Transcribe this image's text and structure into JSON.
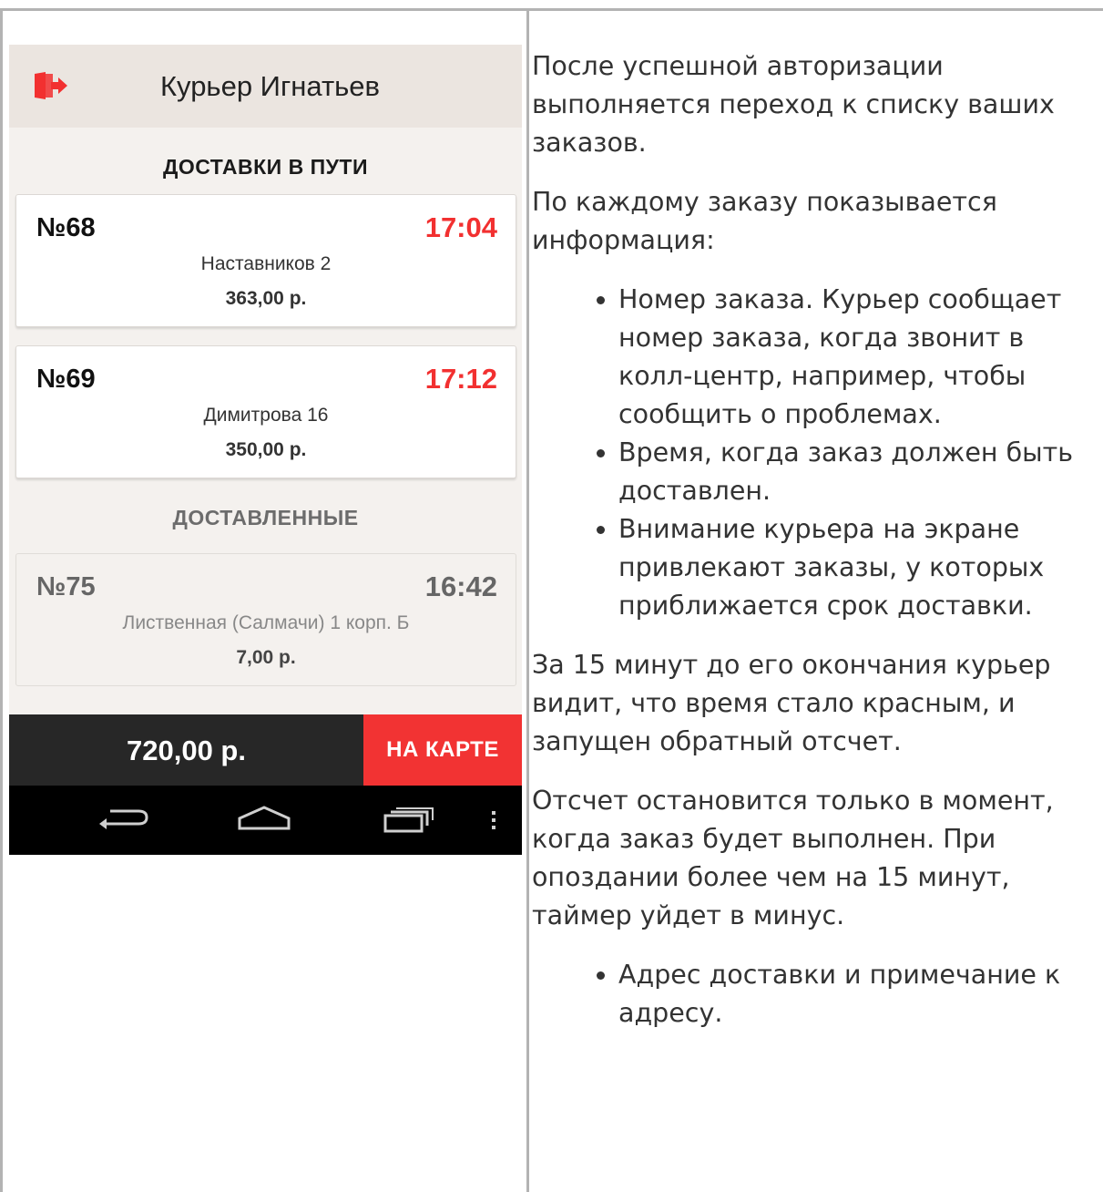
{
  "app": {
    "header": {
      "courier_name": "Курьер Игнатьев",
      "logout_icon": "logout-door-icon",
      "accent": "#f23030"
    },
    "sections": {
      "active_title": "ДОСТАВКИ В ПУТИ",
      "done_title": "ДОСТАВЛЕННЫЕ"
    },
    "active_orders": [
      {
        "number": "№68",
        "time": "17:04",
        "address": "Наставников 2",
        "price": "363,00 р."
      },
      {
        "number": "№69",
        "time": "17:12",
        "address": "Димитрова 16",
        "price": "350,00 р."
      }
    ],
    "done_orders": [
      {
        "number": "№75",
        "time": "16:42",
        "address": "Лиственная (Салмачи) 1 корп. Б",
        "price": "7,00 р."
      }
    ],
    "bottom_bar": {
      "total": "720,00 р.",
      "map_button": "НА КАРТЕ"
    },
    "nav_bar": {
      "icons": [
        "back-icon",
        "home-icon",
        "recent-apps-icon",
        "menu-overflow-icon"
      ]
    }
  },
  "doc": {
    "p1": "После успешной авторизации выполняется переход к списку ваших заказов.",
    "p2": "По каждому заказу показывается информация:",
    "list1": [
      "Номер заказа. Курьер сообщает номер заказа, когда звонит в колл-центр, например, чтобы сообщить о проблемах.",
      "Время, когда заказ должен быть доставлен.",
      "Внимание курьера на экране привлекают заказы, у которых приближается срок доставки."
    ],
    "p3": "За 15 минут до его окончания курьер видит, что время стало красным, и запущен обратный отсчет.",
    "p4": "Отсчет остановится только в момент, когда заказ будет выполнен. При опоздании более чем на 15 минут, таймер уйдет в минус.",
    "list2": [
      "Адрес доставки и примечание к адресу."
    ]
  }
}
